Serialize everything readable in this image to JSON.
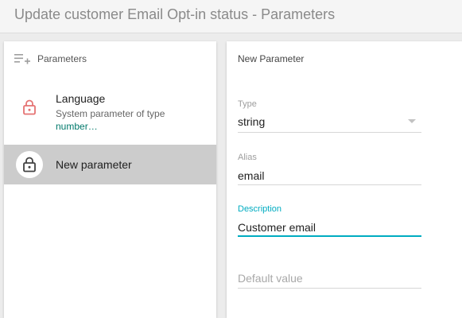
{
  "header": {
    "title": "Update customer Email Opt-in status - Parameters"
  },
  "left_panel": {
    "title": "Parameters",
    "items": [
      {
        "name": "Language",
        "desc": "System parameter of type",
        "type": "number…",
        "icon": "lock-icon"
      },
      {
        "name": "New parameter",
        "icon": "lock-icon",
        "selected": true
      }
    ]
  },
  "right_panel": {
    "title": "New Parameter",
    "type": {
      "label": "Type",
      "value": "string"
    },
    "alias": {
      "label": "Alias",
      "value": "email"
    },
    "description": {
      "label": "Description",
      "value": "Customer email"
    },
    "default_value": {
      "placeholder": "Default value",
      "value": ""
    }
  },
  "colors": {
    "accent": "#00acc1",
    "lock_red": "#e57373",
    "selected_bg": "#cccccc",
    "type_teal": "#00796b"
  }
}
